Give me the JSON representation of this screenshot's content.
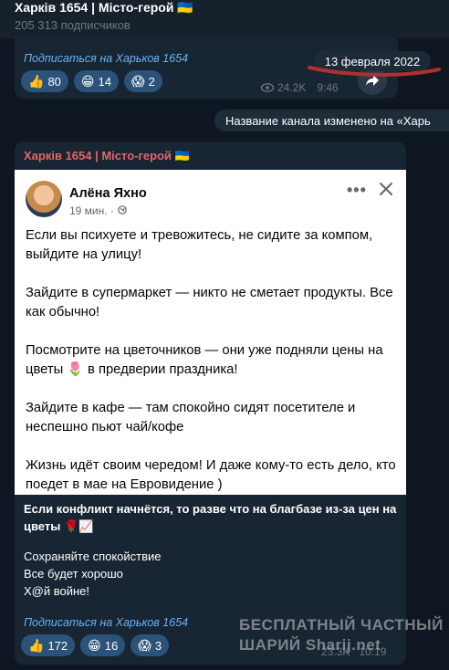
{
  "header": {
    "title": "Харків 1654 | Місто-герой 🇺🇦",
    "subscribers": "205 313 подписчиков"
  },
  "top_post": {
    "subscribe_link": "Подписаться на Харьков 1654",
    "reactions": [
      {
        "emoji": "👍",
        "count": "80"
      },
      {
        "emoji": "😁",
        "count": "14"
      },
      {
        "emoji": "😱",
        "count": "2"
      }
    ],
    "views": "24.2K",
    "time": "9:46"
  },
  "date_badge": "13 февраля 2022",
  "service_message": "Название канала изменено на «Харь",
  "main_post": {
    "author": "Харків 1654 | Місто-герой 🇺🇦",
    "fb": {
      "name": "Алёна Яхно",
      "time": "19 мин. ·",
      "dots": "•••",
      "paragraphs": [
        "Если вы психуете и тревожитесь, не сидите за компом, выйдите на улицу!",
        "Зайдите в супермаркет — никто не сметает продукты. Все как обычно!",
        "Посмотрите на цветочников — они уже подняли цены на цветы 🌷 в предверии праздника!",
        "Зайдите в кафе — там спокойно сидят посетителе и неспешно пьют чай/кофе",
        "Жизнь идёт своим чередом! И даже кому-то есть дело, кто поедет в мае на Евровидение )"
      ]
    },
    "caption_bold": "Если конфликт начнётся, то разве что на благбазе из-за цен на цветы 🌹📈",
    "caption_lines": [
      "Сохраняйте спокойствие",
      "Все будет хорошо",
      "Х@й войне!"
    ],
    "subscribe_link": "Подписаться на Харьков 1654",
    "reactions": [
      {
        "emoji": "👍",
        "count": "172"
      },
      {
        "emoji": "😁",
        "count": "16"
      },
      {
        "emoji": "😱",
        "count": "3"
      }
    ],
    "views": "23.3K",
    "time": "10:19"
  },
  "watermark": {
    "line1": "БЕСПЛАТНЫЙ ЧАСТНЫЙ",
    "line2": "ШАРИЙ Sharij.net"
  },
  "colors": {
    "background": "#0e1621",
    "bubble": "#182533",
    "link": "#6ab2f2",
    "author": "#e56767",
    "reaction": "#2b5278",
    "underline": "#b0302d"
  }
}
